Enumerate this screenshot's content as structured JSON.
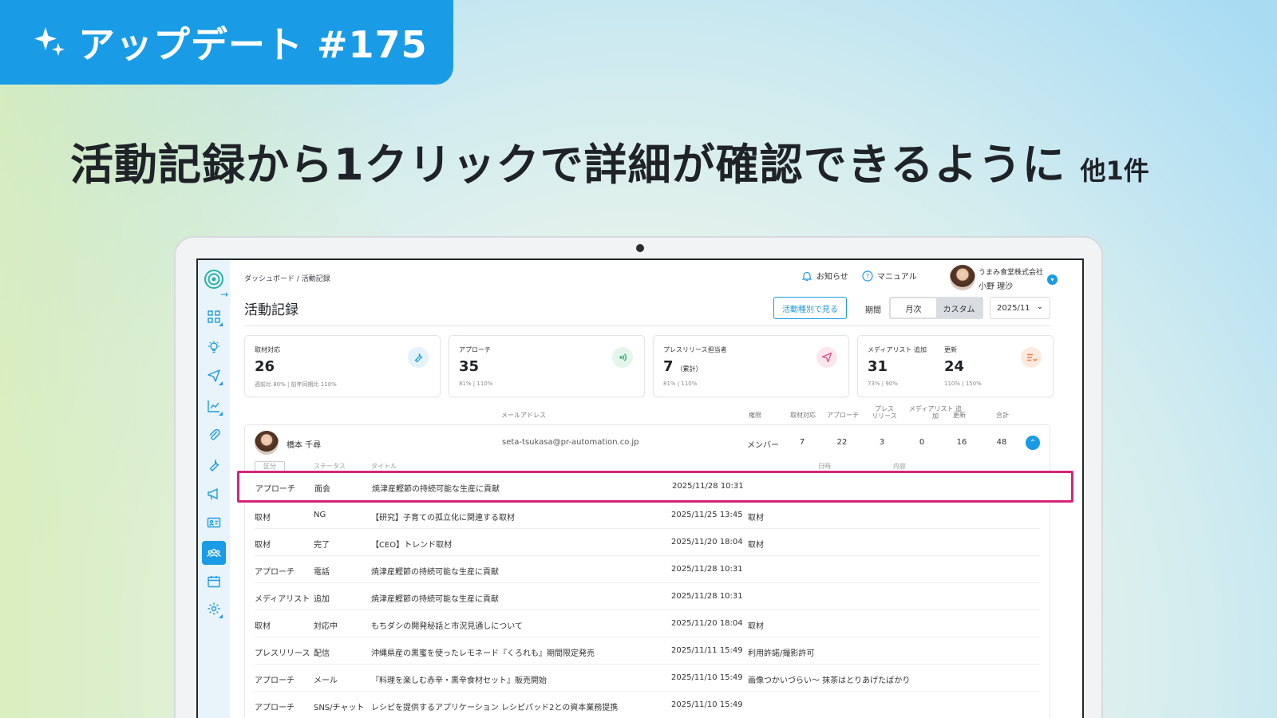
{
  "badge": {
    "text": "アップデート #175",
    "icon": "sparkle-icon",
    "color": "#1a9be6"
  },
  "headline": {
    "main": "活動記録から1クリックで詳細が確認できるように",
    "sub": "他1件"
  },
  "app": {
    "breadcrumb": "ダッシュボード / 活動記録",
    "notifications_label": "お知らせ",
    "manual_label": "マニュアル",
    "user": {
      "company": "うまみ食堂株式会社",
      "name": "小野 理沙"
    },
    "page_title": "活動記録",
    "view_by_type_button": "活動種別で見る",
    "period_label": "期間",
    "period_options": [
      "月次",
      "カスタム"
    ],
    "period_selected": "月次",
    "month_value": "2025/11",
    "stats": [
      {
        "label": "取材対応",
        "value": "26",
        "compare": "週前比 80% | 前年同期比 110%",
        "icon": "wrench-icon"
      },
      {
        "label": "アプローチ",
        "value": "35",
        "compare": "81% | 110%",
        "icon": "signal-icon"
      },
      {
        "label": "プレスリリース担当者",
        "value": "7",
        "suffix": "（累計）",
        "compare": "81% | 110%",
        "icon": "send-icon"
      },
      {
        "label": "メディアリスト 追加",
        "value": "31",
        "compare": "73% | 90%",
        "label2": "更新",
        "value2": "24",
        "compare2": "110% | 150%",
        "icon": "list-icon"
      }
    ],
    "member_headers": {
      "email": "メールアドレス",
      "role": "権限",
      "interview": "取材対応",
      "approach": "アプローチ",
      "press": "プレス リリース",
      "media_add": "メディアリスト 追加",
      "update": "更新",
      "total": "合計"
    },
    "member": {
      "name": "橋本 千尋",
      "email": "seta-tsukasa@pr-automation.co.jp",
      "role": "メンバー",
      "interview": "7",
      "approach": "22",
      "press": "3",
      "media_add": "0",
      "update": "16",
      "total": "48"
    },
    "activity_headers": {
      "category": "区分",
      "status": "ステータス",
      "title": "タイトル",
      "datetime": "日時",
      "content": "内容"
    },
    "activities": [
      {
        "category": "アプローチ",
        "status": "面会",
        "title": "焼津産鰹節の持続可能な生産に貢献",
        "datetime": "2025/11/28 10:31",
        "content": ""
      },
      {
        "category": "取材",
        "status": "NG",
        "title": "【研究】子育ての孤立化に関連する取材",
        "datetime": "2025/11/25 13:45",
        "content": "取材"
      },
      {
        "category": "取材",
        "status": "完了",
        "title": "【CEO】トレンド取材",
        "datetime": "2025/11/20 18:04",
        "content": "取材"
      },
      {
        "category": "アプローチ",
        "status": "電話",
        "title": "焼津産鰹節の持続可能な生産に貢献",
        "datetime": "2025/11/28 10:31",
        "content": ""
      },
      {
        "category": "メディアリスト",
        "status": "追加",
        "title": "焼津産鰹節の持続可能な生産に貢献",
        "datetime": "2025/11/28 10:31",
        "content": ""
      },
      {
        "category": "取材",
        "status": "対応中",
        "title": "もちダシの開発秘話と市況見通しについて",
        "datetime": "2025/11/20 18:04",
        "content": "取材"
      },
      {
        "category": "プレスリリース",
        "status": "配信",
        "title": "沖縄県産の黒蜜を使ったレモネード『くろれも』期間限定発売",
        "datetime": "2025/11/11 15:49",
        "content": "利用許諾/撮影許可"
      },
      {
        "category": "アプローチ",
        "status": "メール",
        "title": "『料理を楽しむ赤辛・黒辛食材セット』販売開始",
        "datetime": "2025/11/10 15:49",
        "content": "画像つかいづらい～ 抹茶はとりあげたばかり"
      },
      {
        "category": "アプローチ",
        "status": "SNS/チャット",
        "title": "レシピを提供するアプリケーション レシピパッド2との資本業務提携",
        "datetime": "2025/11/10 15:49",
        "content": ""
      }
    ],
    "sidebar_icons": [
      "dashboard-icon",
      "idea-icon",
      "send-icon",
      "chart-icon",
      "clip-icon",
      "wrench-icon",
      "megaphone-icon",
      "contact-card-icon",
      "team-icon",
      "calendar-icon",
      "settings-icon"
    ],
    "highlight_color": "#d6237a"
  }
}
